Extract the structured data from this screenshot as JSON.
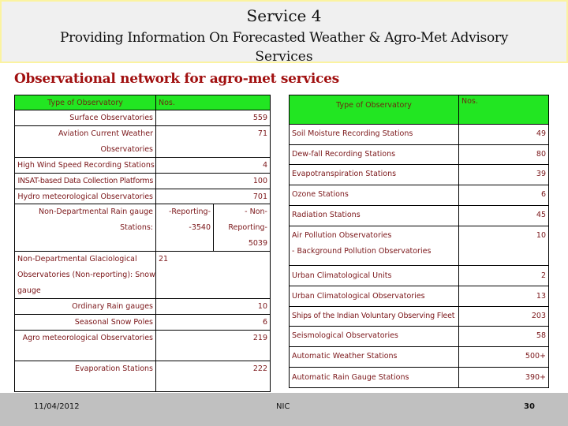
{
  "title": {
    "line1": "Service 4",
    "line2": "Providing Information On Forecasted Weather & Agro-Met Advisory",
    "line3": "Services"
  },
  "subtitle": "Observational network for agro-met services",
  "colors": {
    "header_green": "#22e622",
    "text_maroon": "#7a1518",
    "subtitle_red": "#a11010",
    "footer_gray": "#c0c0c0"
  },
  "left_table": {
    "header": {
      "type": "Type of Observatory",
      "nos": "Nos."
    },
    "rows": [
      {
        "type": "Surface Observatories",
        "nos": "559"
      },
      {
        "type": "Aviation Current Weather",
        "type2": "Observatories",
        "nos": "71"
      },
      {
        "type": "High Wind Speed Recording Stations",
        "nos": "4"
      },
      {
        "type": "INSAT-based Data Collection Platforms",
        "nos": "100"
      },
      {
        "type": "Hydro meteorological Observatories",
        "nos": "701"
      },
      {
        "type": "Non-Departmental Rain gauge",
        "type2": "Stations:",
        "reporting": "-Reporting-",
        "reporting_val": "-3540",
        "non_reporting": "- Non-",
        "non_reporting2": "Reporting-",
        "non_reporting_val": "5039"
      },
      {
        "type": "Non-Departmental Glaciological",
        "type2": "Observatories (Non-reporting): Snow",
        "type3": "gauge",
        "nos": "21"
      },
      {
        "type": "Ordinary Rain gauges",
        "nos": "10"
      },
      {
        "type": "Seasonal Snow Poles",
        "nos": "6"
      },
      {
        "type": "Agro meteorological Observatories",
        "nos": "219"
      },
      {
        "type": "Evaporation Stations",
        "nos": "222"
      }
    ]
  },
  "right_table": {
    "header": {
      "type": "Type of Observatory",
      "nos": "Nos."
    },
    "rows": [
      {
        "type": "Soil Moisture Recording Stations",
        "nos": "49"
      },
      {
        "type": "Dew-fall Recording Stations",
        "nos": "80"
      },
      {
        "type": "Evapotranspiration Stations",
        "nos": "39"
      },
      {
        "type": "Ozone Stations",
        "nos": "6"
      },
      {
        "type": "Radiation Stations",
        "nos": "45"
      },
      {
        "type": "Air Pollution Observatories",
        "type2": "- Background Pollution Observatories",
        "nos": "10"
      },
      {
        "type": "Urban Climatological Units",
        "nos": "2"
      },
      {
        "type": "Urban Climatological Observatories",
        "nos": "13"
      },
      {
        "type": "Ships of the Indian Voluntary Observing Fleet",
        "nos": "203"
      },
      {
        "type": "Seismological Observatories",
        "nos": "58"
      },
      {
        "type": "Automatic Weather Stations",
        "nos": "500+"
      },
      {
        "type": "Automatic Rain Gauge Stations",
        "nos": "390+"
      }
    ]
  },
  "footer": {
    "date": "11/04/2012",
    "center": "NIC",
    "page": "30"
  }
}
